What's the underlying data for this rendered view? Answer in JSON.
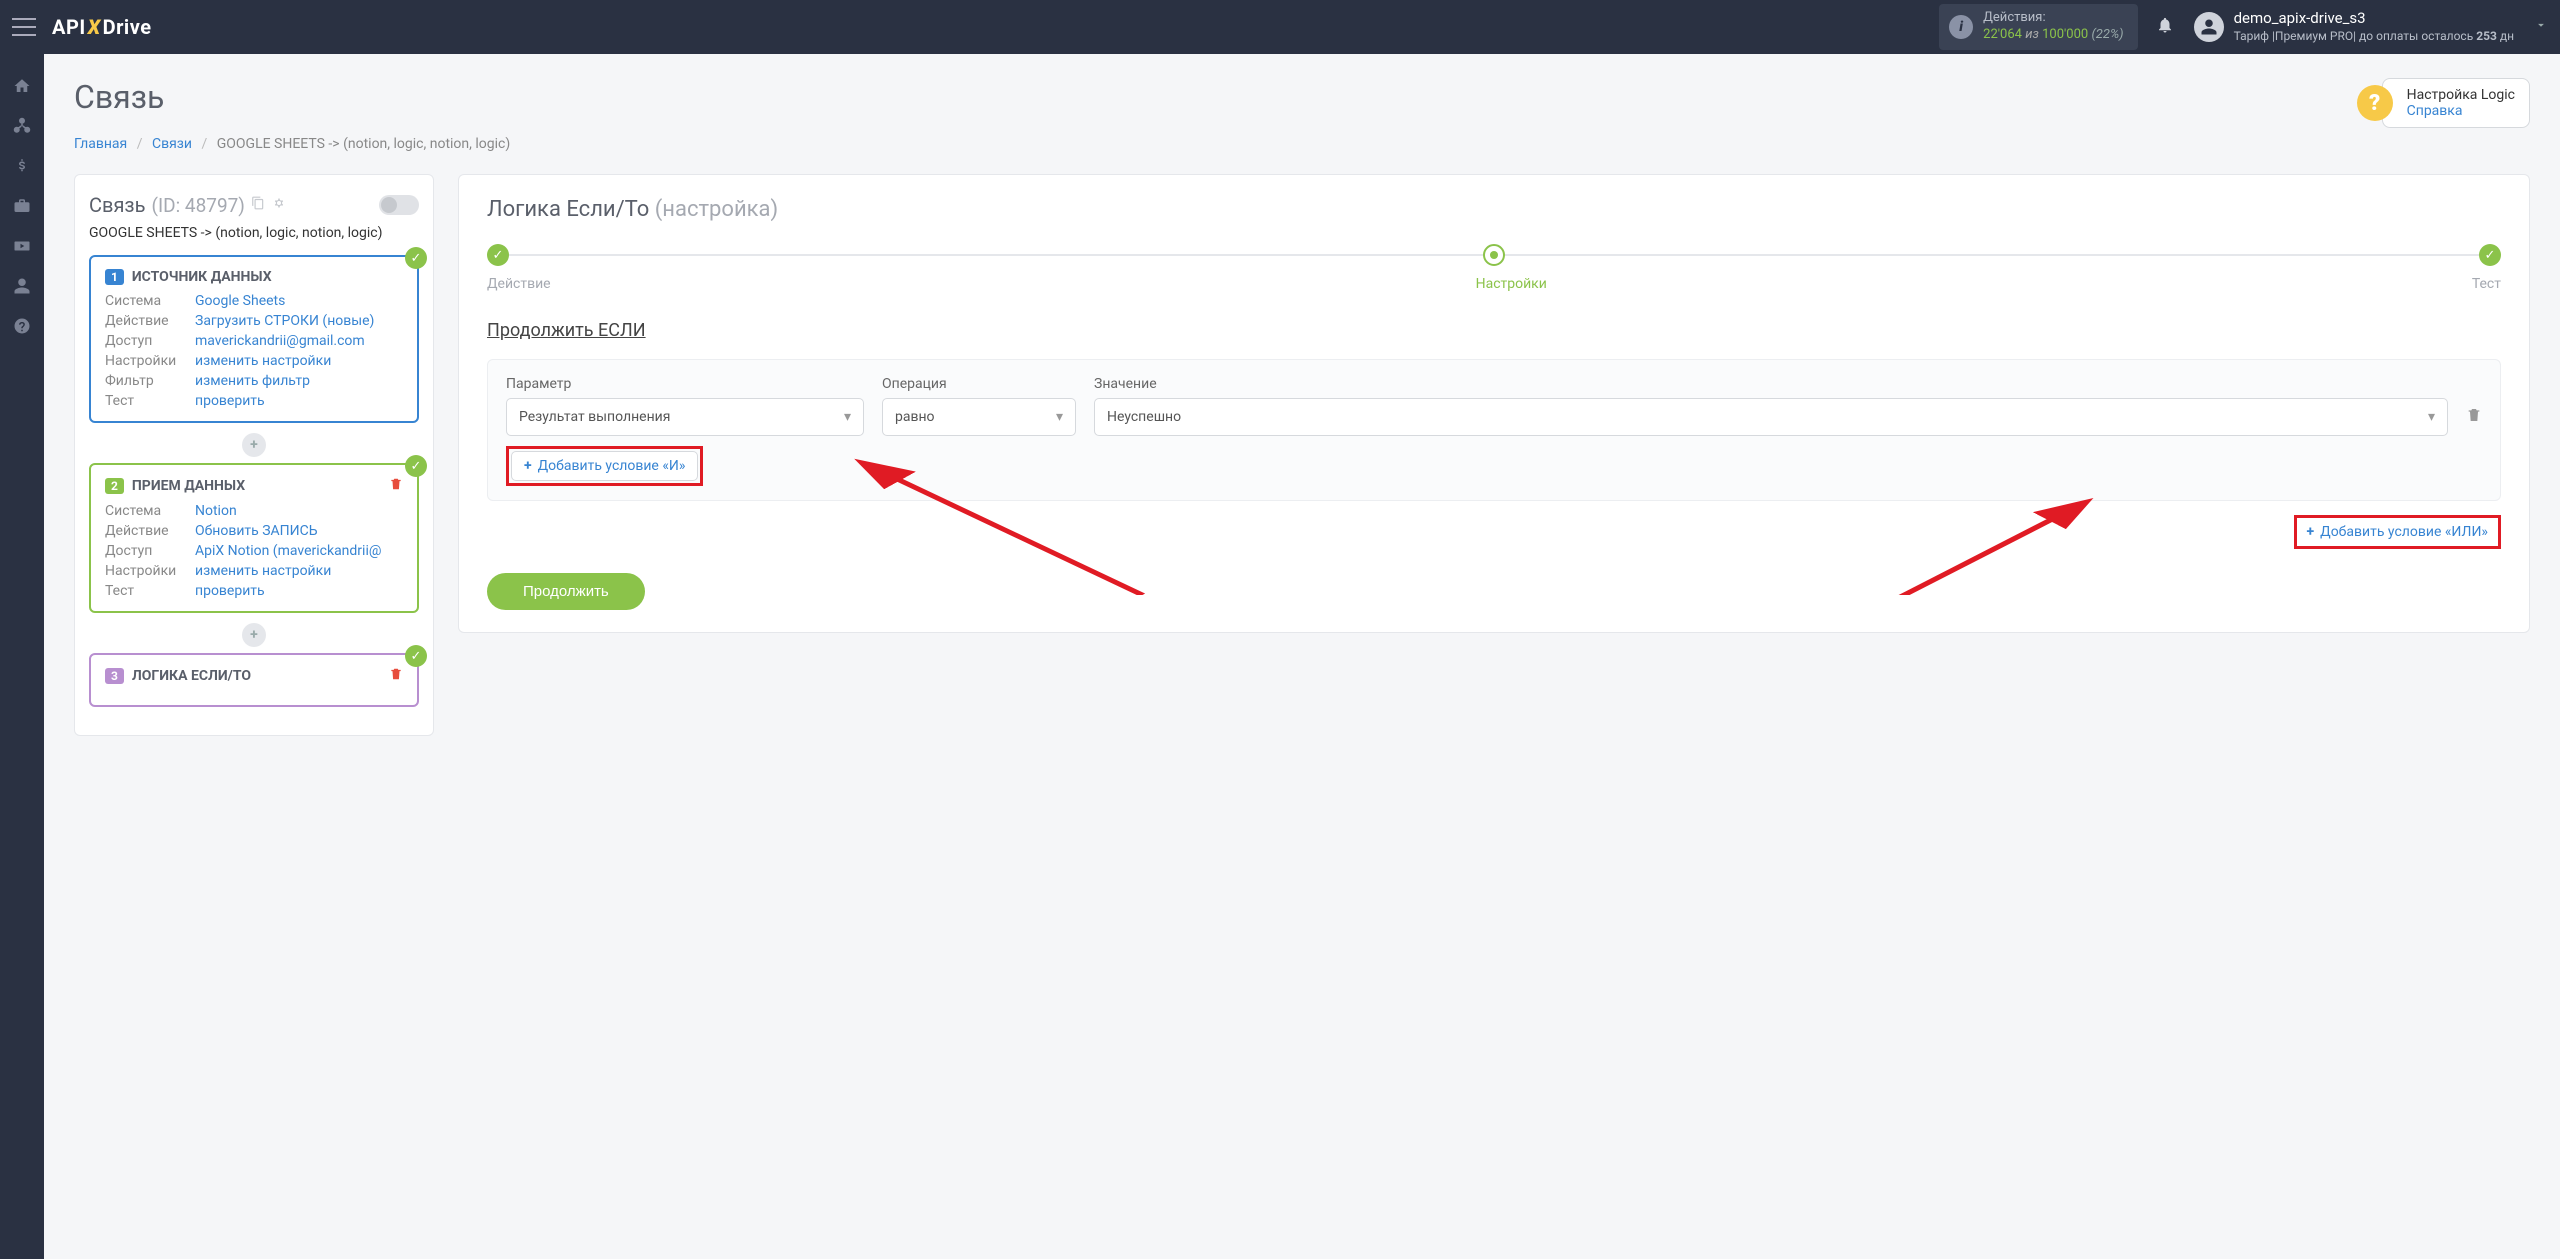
{
  "header": {
    "actions_label": "Действия:",
    "actions_count": "22'064",
    "actions_of": "из",
    "actions_total": "100'000",
    "actions_pct": "(22%)",
    "user_name": "demo_apix-drive_s3",
    "tariff_prefix": "Тариф |Премиум PRO| до оплаты осталось ",
    "tariff_days": "253",
    "tariff_suffix": " дн"
  },
  "help": {
    "title": "Настройка Logic",
    "link": "Справка"
  },
  "page": {
    "title": "Связь"
  },
  "breadcrumb": {
    "home": "Главная",
    "connections": "Связи",
    "current": "GOOGLE SHEETS -> (notion, logic, notion, logic)"
  },
  "conn": {
    "title": "Связь",
    "id": "(ID: 48797)",
    "path": "GOOGLE SHEETS -> (notion, logic, notion, logic)"
  },
  "block1": {
    "num": "1",
    "title": "ИСТОЧНИК ДАННЫХ",
    "rows": {
      "system_l": "Система",
      "system_v": "Google Sheets",
      "action_l": "Действие",
      "action_v": "Загрузить СТРОКИ (новые)",
      "access_l": "Доступ",
      "access_v": "maverickandrii@gmail.com",
      "settings_l": "Настройки",
      "settings_v": "изменить настройки",
      "filter_l": "Фильтр",
      "filter_v": "изменить фильтр",
      "test_l": "Тест",
      "test_v": "проверить"
    }
  },
  "block2": {
    "num": "2",
    "title": "ПРИЕМ ДАННЫХ",
    "rows": {
      "system_l": "Система",
      "system_v": "Notion",
      "action_l": "Действие",
      "action_v": "Обновить ЗАПИСЬ",
      "access_l": "Доступ",
      "access_v": "ApiX Notion (maverickandrii@",
      "settings_l": "Настройки",
      "settings_v": "изменить настройки",
      "test_l": "Тест",
      "test_v": "проверить"
    }
  },
  "block3": {
    "num": "3",
    "title": "ЛОГИКА ЕСЛИ/ТО"
  },
  "panel": {
    "title": "Логика Если/То",
    "subtitle": "(настройка)",
    "steps": {
      "s1": "Действие",
      "s2": "Настройки",
      "s3": "Тест"
    },
    "section": "Продолжить ЕСЛИ",
    "filter": {
      "param_label": "Параметр",
      "op_label": "Операция",
      "val_label": "Значение",
      "param_value": "Результат выполнения",
      "op_value": "равно",
      "val_value": "Неуспешно",
      "add_and": "Добавить условие «И»"
    },
    "add_or": "Добавить условие «ИЛИ»",
    "continue": "Продолжить"
  }
}
